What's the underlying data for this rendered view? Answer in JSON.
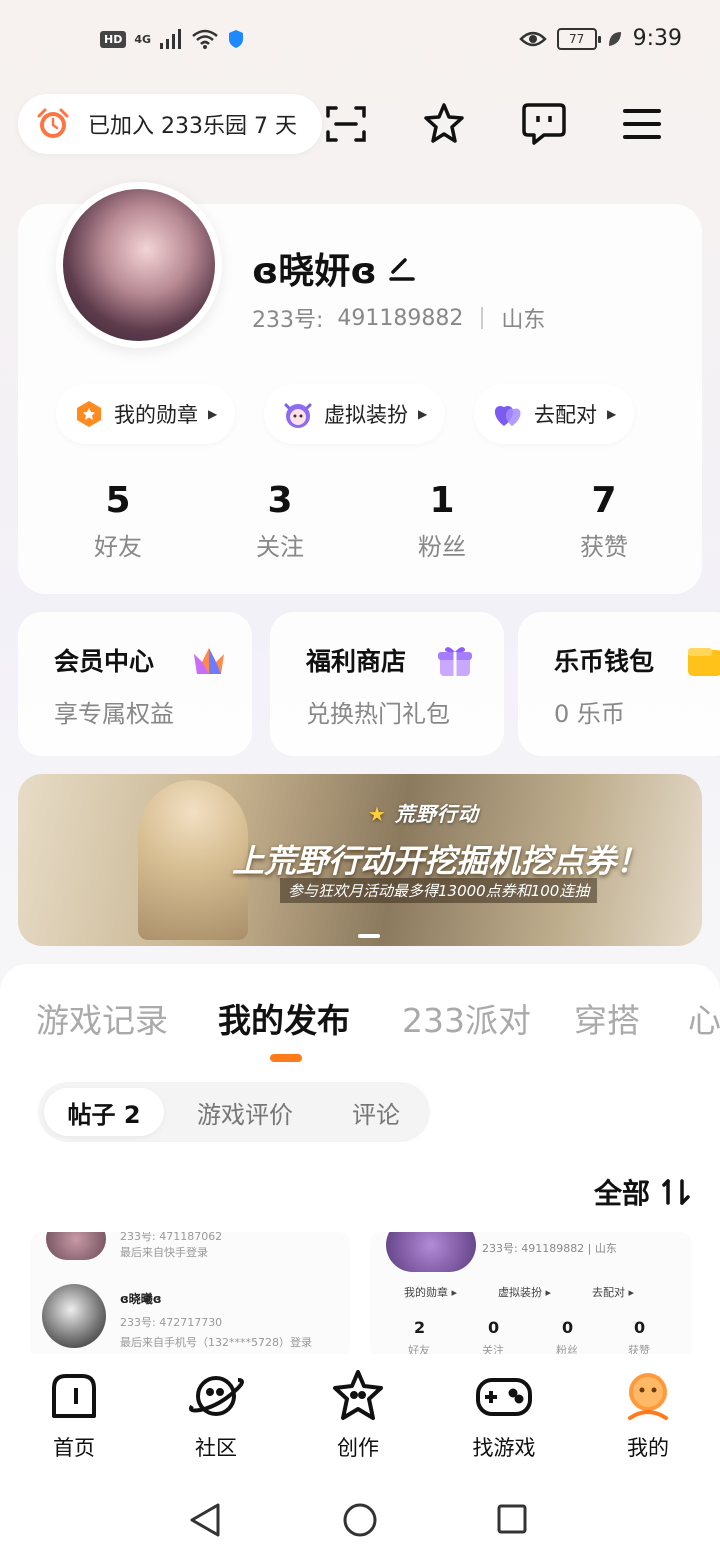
{
  "status_bar": {
    "left_badge": "HD",
    "network": "4G",
    "battery": "77",
    "time": "9:39"
  },
  "topbar": {
    "join_text": "已加入 233乐园 7 天",
    "icons": [
      "alarm-clock-icon",
      "scan-icon",
      "star-icon",
      "message-icon",
      "menu-icon"
    ]
  },
  "profile": {
    "nickname": "ɞ晓妍ɞ",
    "uid_label": "233号:",
    "uid": "491189882",
    "region": "山东",
    "chips": [
      {
        "label": "我的勋章",
        "icon": "medal-icon"
      },
      {
        "label": "虚拟装扮",
        "icon": "avatar-costume-icon"
      },
      {
        "label": "去配对",
        "icon": "heart-match-icon"
      }
    ],
    "stats": [
      {
        "value": "5",
        "label": "好友"
      },
      {
        "value": "3",
        "label": "关注"
      },
      {
        "value": "1",
        "label": "粉丝"
      },
      {
        "value": "7",
        "label": "获赞"
      }
    ]
  },
  "services": [
    {
      "title": "会员中心",
      "subtitle": "享专属权益",
      "icon": "crown-icon"
    },
    {
      "title": "福利商店",
      "subtitle": "兑换热门礼包",
      "icon": "gift-icon"
    },
    {
      "title": "乐币钱包",
      "subtitle": "0 乐币",
      "icon": "wallet-icon"
    }
  ],
  "banner": {
    "logo": "荒野行动",
    "title": "上荒野行动开挖掘机挖点券！",
    "subtitle": "参与狂欢月活动最多得13000点券和100连抽"
  },
  "tabs": [
    "游戏记录",
    "我的发布",
    "233派对",
    "穿搭",
    "心"
  ],
  "active_tab": "我的发布",
  "subtabs": [
    "帖子 2",
    "游戏评价",
    "评论"
  ],
  "sort_label": "全部",
  "post_preview_1": {
    "row1_uid": "233号: 471187062",
    "row1_login": "最后来自快手登录",
    "row2_name": "ɞ晓曦ɞ",
    "row2_uid": "233号: 472717730",
    "row2_login": "最后来自手机号（132****5728）登录"
  },
  "post_preview_2": {
    "uid_line": "233号: 491189882 | 山东",
    "chips": [
      "我的勋章 ▸",
      "虚拟装扮 ▸",
      "去配对 ▸"
    ],
    "stats": [
      "2",
      "0",
      "0",
      "0"
    ],
    "stat_labels": [
      "好友",
      "关注",
      "粉丝",
      "获赞"
    ]
  },
  "bottom_nav": [
    {
      "label": "首页",
      "icon": "home-icon"
    },
    {
      "label": "社区",
      "icon": "planet-icon"
    },
    {
      "label": "创作",
      "icon": "star-create-icon"
    },
    {
      "label": "找游戏",
      "icon": "gamepad-icon"
    },
    {
      "label": "我的",
      "icon": "profile-face-icon"
    }
  ],
  "colors": {
    "accent": "#ff7a1a",
    "text_primary": "#111111",
    "text_secondary": "#888888"
  }
}
